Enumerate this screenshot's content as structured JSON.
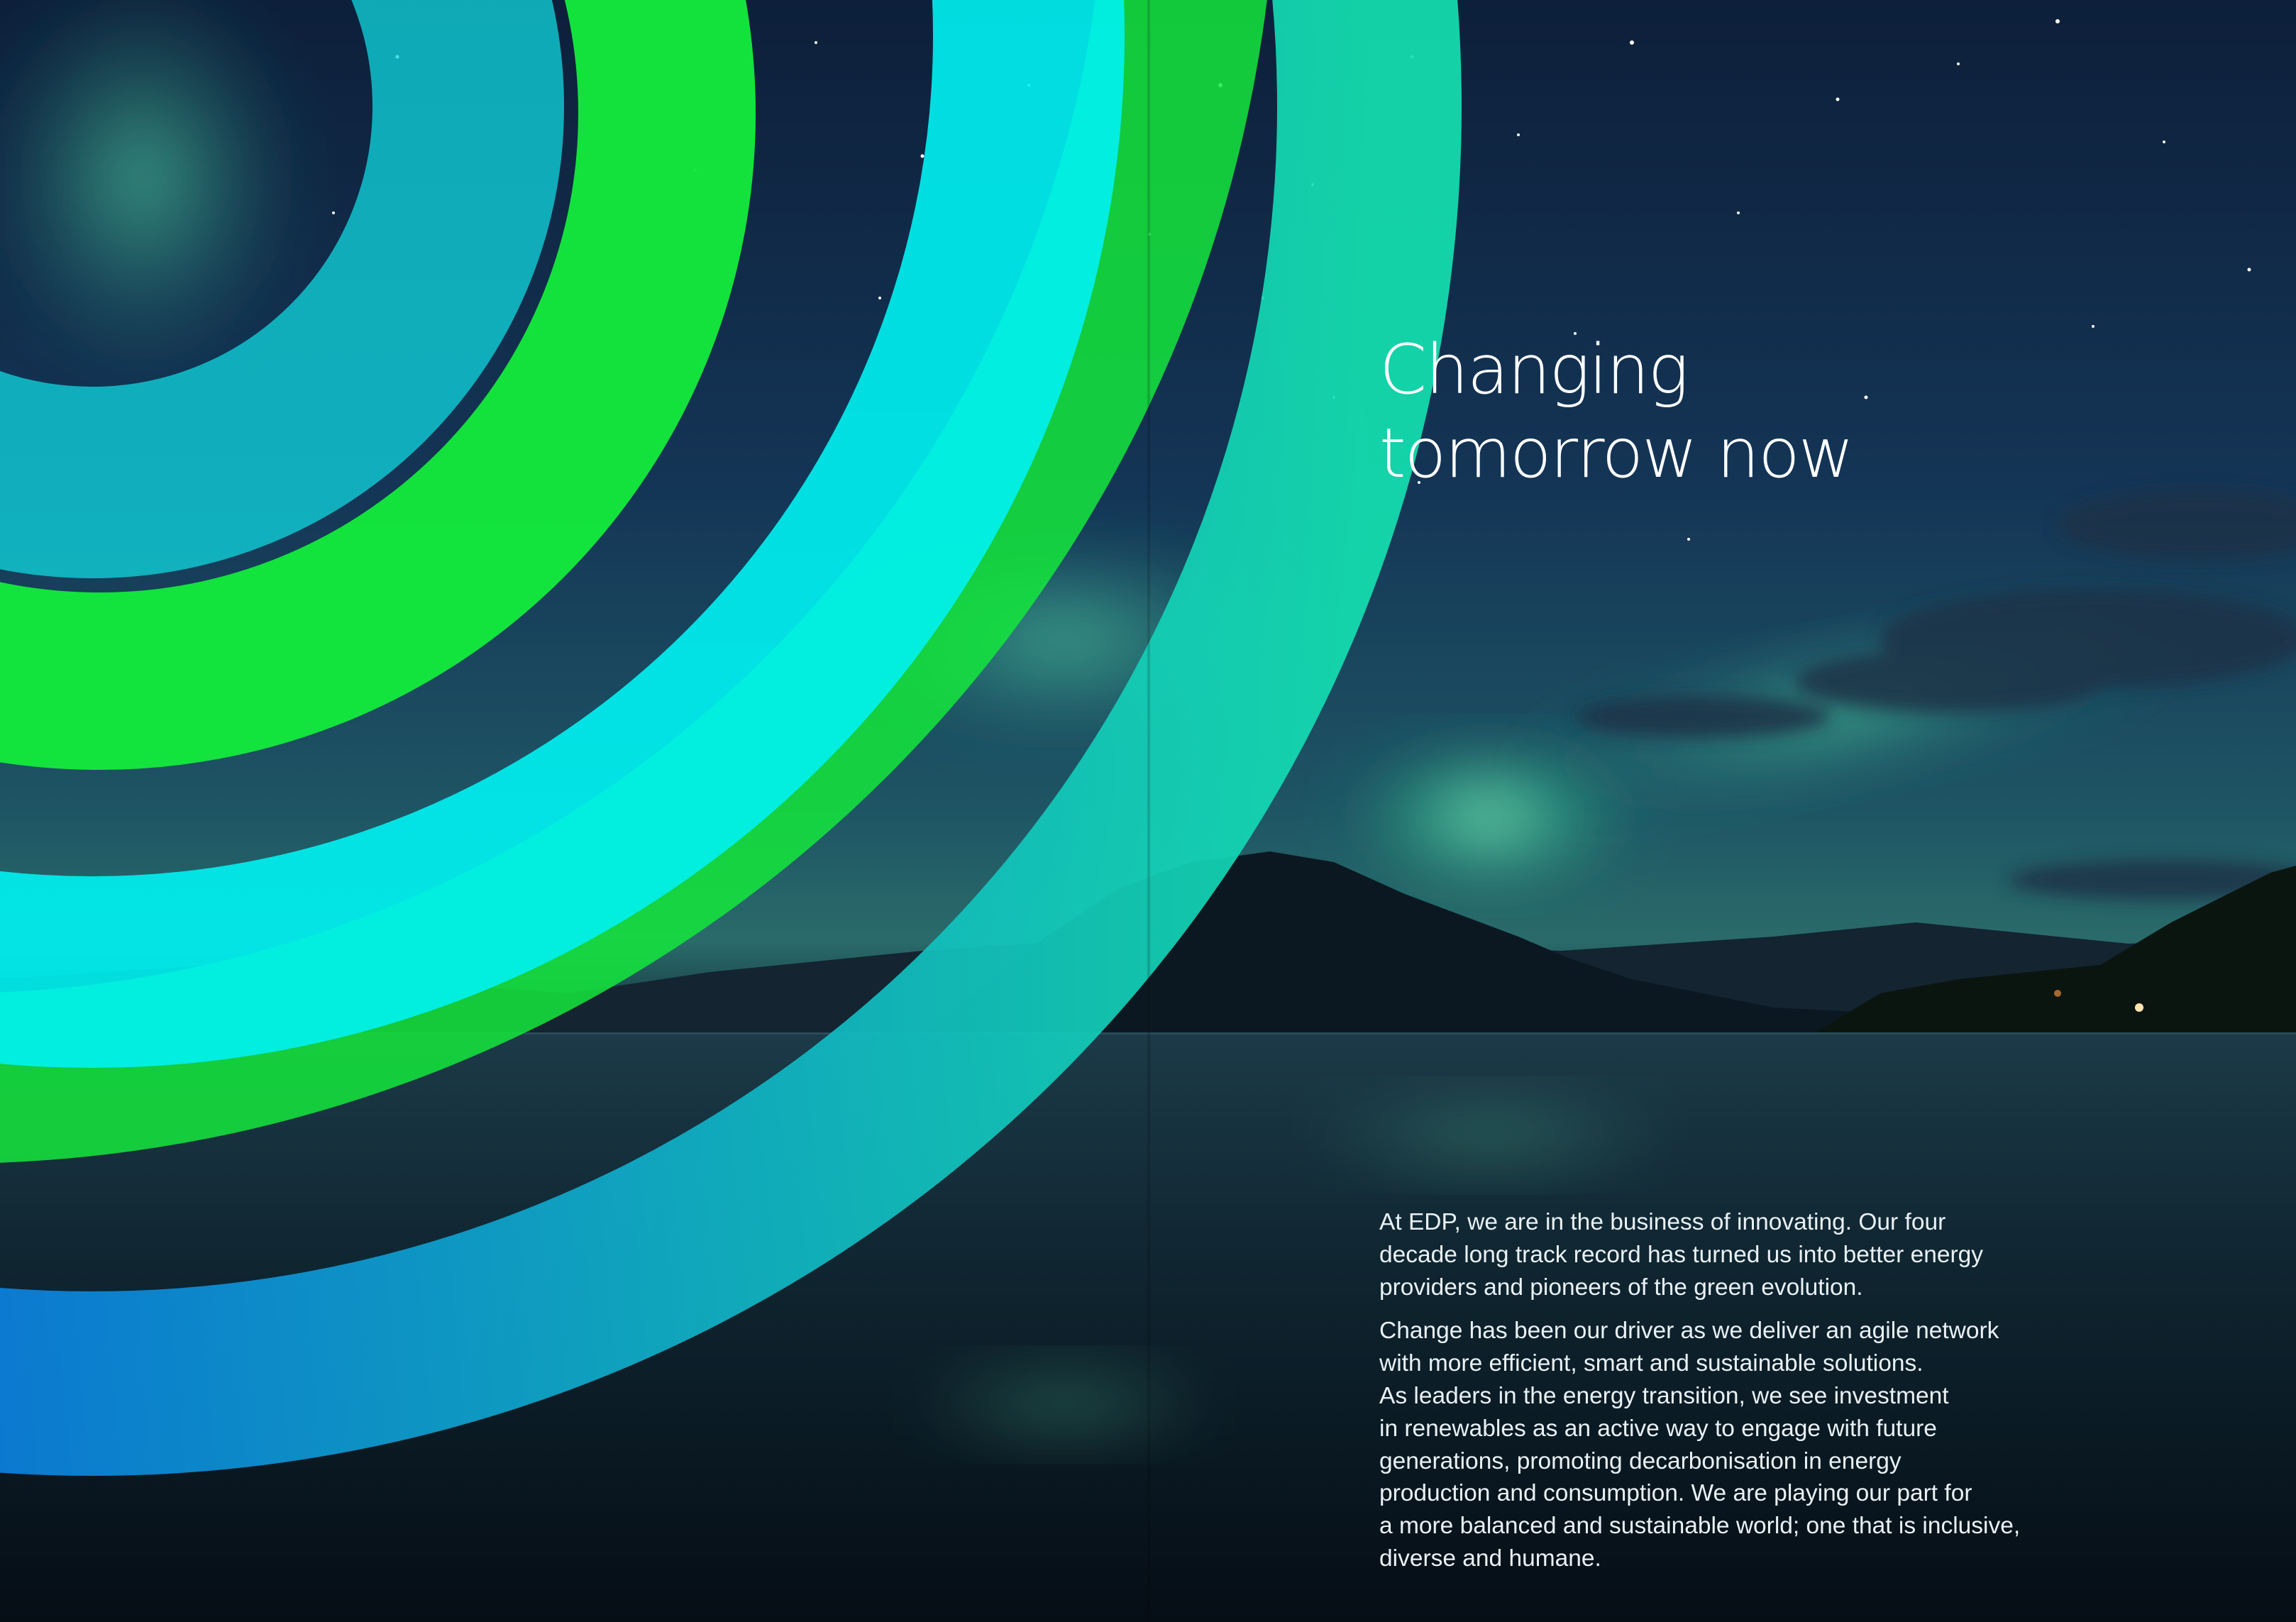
{
  "spread": {
    "headline": [
      "Changing",
      "tomorrow now"
    ],
    "paragraphs": [
      [
        "At EDP, we are in the business of innovating. Our four",
        "decade long track record has turned us into better energy",
        "providers and pioneers of the green evolution."
      ],
      [
        "Change has been our driver as we deliver an agile network",
        "with more efficient, smart and sustainable solutions.",
        "As leaders in the energy transition, we see investment",
        "in renewables as an active way to engage with future",
        "generations, promoting decarbonisation in energy",
        "production and consumption. We are playing our part for",
        "a more balanced and sustainable world; one that is inclusive,",
        "diverse and humane."
      ]
    ]
  },
  "colors": {
    "ring_green": "#14e83c",
    "ring_cyan": "#00f2f2",
    "ring_blue": "#0a2ee8",
    "sky_dark": "#0b1c33",
    "aurora": "#3cf0a0",
    "text": "#ffffff"
  }
}
